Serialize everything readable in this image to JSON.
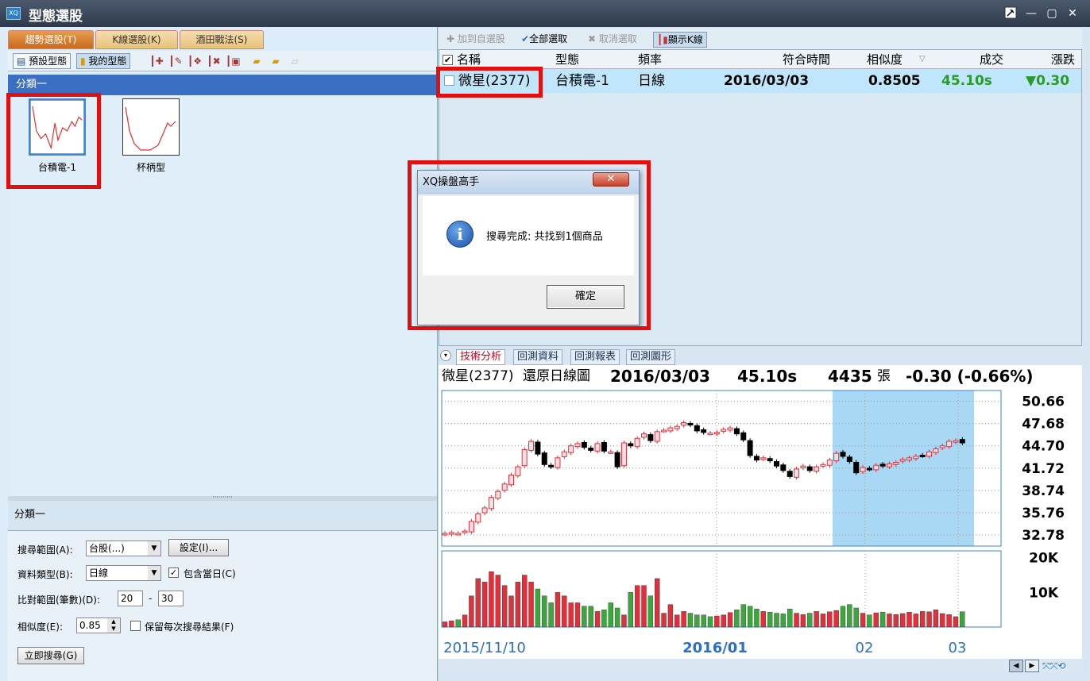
{
  "window": {
    "title": "型態選股",
    "logo": "XQ",
    "buttons": [
      "pin-icon",
      "minimize-icon",
      "maximize-icon",
      "close-icon"
    ]
  },
  "left_tabs": [
    {
      "label": "趨勢選股(T)",
      "selected": true
    },
    {
      "label": "K線選股(K)",
      "selected": false
    },
    {
      "label": "酒田戰法(S)",
      "selected": false
    }
  ],
  "left_toolbar": {
    "preset": "預設型態",
    "mine": "我的型態"
  },
  "category": {
    "title": "分類一"
  },
  "patterns": [
    {
      "name": "台積電-1",
      "selected": true
    },
    {
      "name": "杯柄型",
      "selected": false
    }
  ],
  "settings": {
    "header": "分類一",
    "scope_label": "搜尋範圍(A):",
    "scope_value": "台股(...)",
    "setup_button": "設定(I)...",
    "datatype_label": "資料類型(B):",
    "datatype_value": "日線",
    "include_today_label": "包含當日(C)",
    "include_today": true,
    "range_label": "比對範圍(筆數)(D):",
    "range_from": "20",
    "range_sep": "-",
    "range_to": "30",
    "similarity_label": "相似度(E):",
    "similarity_value": "0.85",
    "keep_label": "保留每次搜尋結果(F)",
    "keep": false,
    "search_button": "立即搜尋(G)"
  },
  "right_toolbar": {
    "add_watch": "加到自選股",
    "select_all": "全部選取",
    "deselect": "取消選取",
    "show_k": "顯示K線"
  },
  "grid": {
    "headers": [
      "名稱",
      "型態",
      "頻率",
      "符合時間",
      "相似度",
      "成交",
      "漲跌"
    ],
    "rows": [
      {
        "name": "微星(2377)",
        "pattern": "台積電-1",
        "freq": "日線",
        "time": "2016/03/03",
        "sim": "0.8505",
        "price": "45.10s",
        "change": "▼0.30"
      }
    ]
  },
  "bottom_tabs": [
    "技術分析",
    "回測資料",
    "回測報表",
    "回測圖形"
  ],
  "chart_info": {
    "name": "微星(2377)",
    "type": "還原日線圖",
    "date": "2016/03/03",
    "price": "45.10s",
    "volume": "4435",
    "vol_unit": "張",
    "change": "-0.30 (-0.66%)"
  },
  "dialog": {
    "title": "XQ操盤高手",
    "close": "✕",
    "message": "搜尋完成: 共找到1個商品",
    "ok": "確定"
  },
  "colors": {
    "up": "#e0303c",
    "down": "#000000",
    "vol_up": "#e0303c",
    "vol_down": "#3aa83a",
    "highlight": "#a9d8f5",
    "accent_red": "#e01010"
  },
  "chart_data": {
    "type": "candlestick",
    "price_ticks": [
      "50.66",
      "47.68",
      "44.70",
      "41.72",
      "38.74",
      "35.76",
      "32.78"
    ],
    "volume_ticks": [
      "20K",
      "10K"
    ],
    "x_ticks": [
      "2015/11/10",
      "2016/01",
      "02",
      "03"
    ],
    "ylim": [
      31.3,
      52.1
    ],
    "closes": [
      33.0,
      33.1,
      33.0,
      33.3,
      34.6,
      35.6,
      36.4,
      37.8,
      38.6,
      39.6,
      40.8,
      41.9,
      44.2,
      45.3,
      43.6,
      42.2,
      41.9,
      43.1,
      43.9,
      44.7,
      45.0,
      44.5,
      44.1,
      45.0,
      44.0,
      43.9,
      41.9,
      45.1,
      44.7,
      45.7,
      46.3,
      45.4,
      46.6,
      46.8,
      47.1,
      47.3,
      47.8,
      47.5,
      46.7,
      46.5,
      46.4,
      46.5,
      46.9,
      47.1,
      46.3,
      45.5,
      43.4,
      42.8,
      43.1,
      42.7,
      42.0,
      41.4,
      40.6,
      41.6,
      42.0,
      41.4,
      41.9,
      42.2,
      42.8,
      43.7,
      43.3,
      42.6,
      41.1,
      41.8,
      41.6,
      42.1,
      42.0,
      42.3,
      42.5,
      42.9,
      43.1,
      43.3,
      43.4,
      43.9,
      44.3,
      44.7,
      45.3,
      45.4,
      45.1
    ],
    "volumes": [
      1500,
      1800,
      2100,
      3500,
      9000,
      14000,
      13000,
      16000,
      15000,
      12000,
      9000,
      13000,
      15000,
      13000,
      11000,
      9000,
      7000,
      10000,
      9000,
      7000,
      7000,
      6000,
      6000,
      4500,
      5000,
      7000,
      5500,
      3500,
      10000,
      12000,
      12000,
      9000,
      14000,
      4000,
      6500,
      3500,
      4500,
      4000,
      3500,
      3500,
      3000,
      3200,
      3500,
      4200,
      5000,
      6500,
      6000,
      5200,
      4500,
      4300,
      4000,
      3800,
      5200,
      4000,
      3600,
      4000,
      4500,
      3800,
      4400,
      4800,
      6000,
      6500,
      5500,
      4000,
      3500,
      4100,
      4300,
      3800,
      3600,
      3900,
      4300,
      3800,
      4500,
      4400,
      5000,
      3900,
      3600,
      3000,
      4435
    ]
  }
}
